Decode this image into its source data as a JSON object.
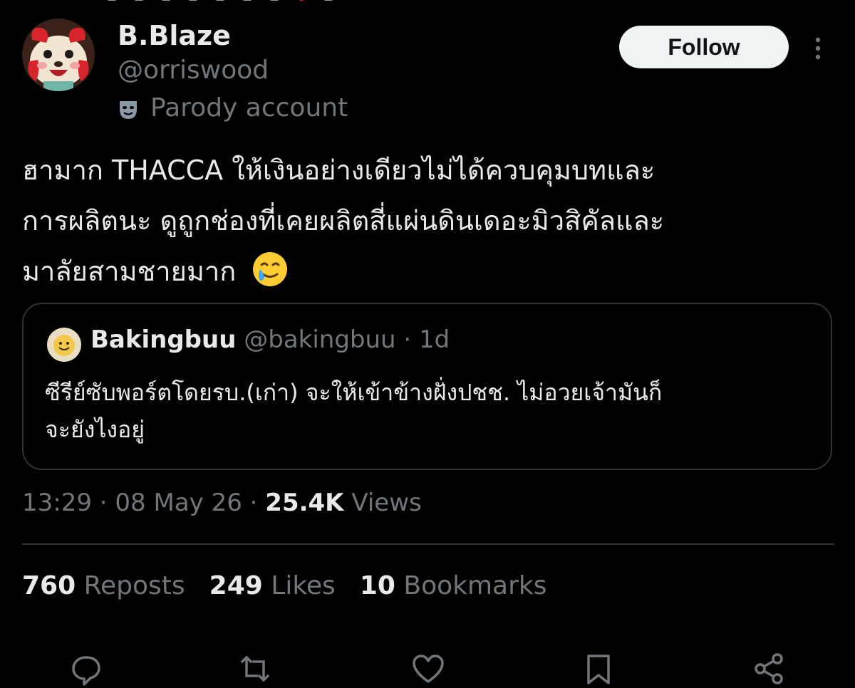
{
  "author": {
    "display_name": "B.Blaze",
    "handle": "@orriswood",
    "label": "Parody account",
    "avatar_icon": "cartoon-avatar-icon"
  },
  "follow_label": "Follow",
  "tweet": {
    "lines": [
      "ฮามาก THACCA ให้เงินอย่างเดียวไม่ได้ควบคุมบทและ",
      "การผลิตนะ ดูถูกช่องที่เคยผลิตสี่แผ่นดินเดอะมิวสิคัลและ",
      "มาลัยสามชายมาก"
    ],
    "emoji_icon": "smiling-face-with-tear-icon"
  },
  "quote": {
    "name": "Bakingbuu",
    "handle": "@bakingbuu",
    "time": "1d",
    "lines": [
      "ซีรีย์ซับพอร์ตโดยรบ.(เก่า) จะให้เข้าข้างฝั่งปชช. ไม่อวยเจ้ามันก็",
      "จะยังไงอยู่"
    ]
  },
  "meta": {
    "time": "13:29",
    "date": "08 May 26",
    "views_count": "25.4K",
    "views_label": "Views"
  },
  "stats": {
    "reposts_count": "760",
    "reposts_label": "Reposts",
    "likes_count": "249",
    "likes_label": "Likes",
    "bookmarks_count": "10",
    "bookmarks_label": "Bookmarks"
  },
  "actions": [
    "reply-icon",
    "repost-icon",
    "like-icon",
    "bookmark-icon",
    "share-icon"
  ],
  "colors": {
    "background": "#000000",
    "text_primary": "#e7e9ea",
    "text_secondary": "#71767b",
    "border": "#2f3336",
    "follow_bg": "#eff3f4"
  }
}
